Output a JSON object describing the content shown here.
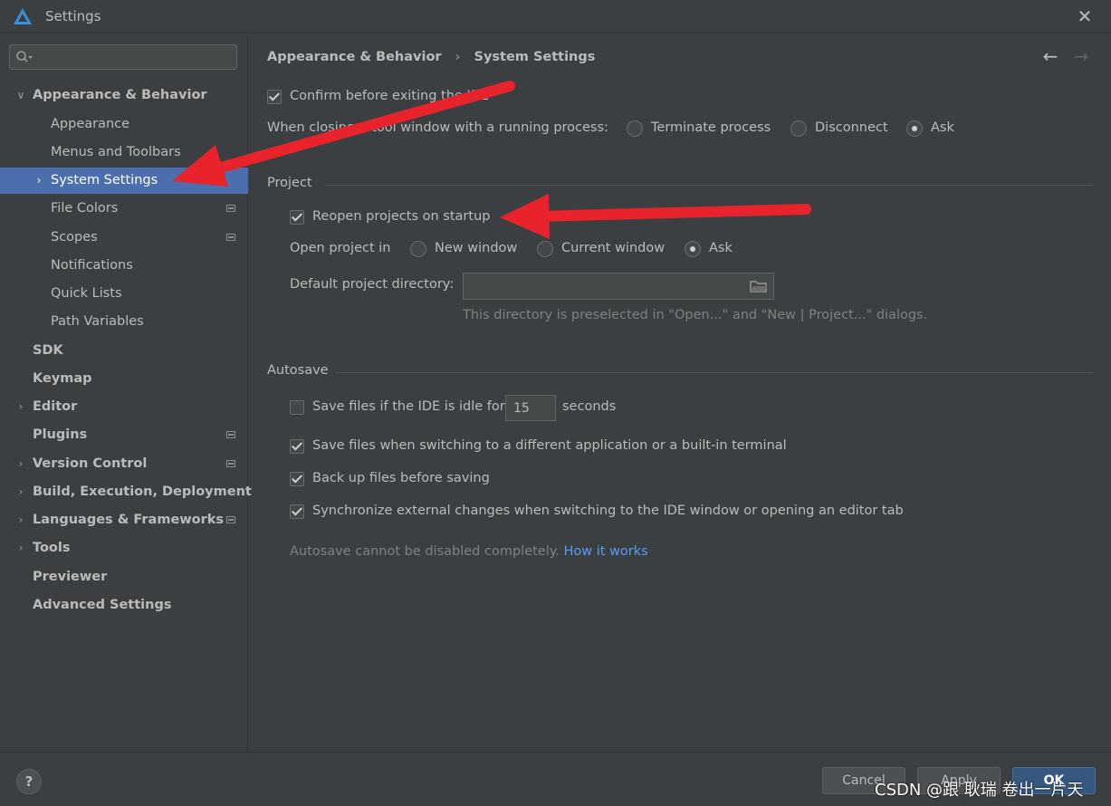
{
  "window": {
    "title": "Settings"
  },
  "search": {
    "placeholder": "",
    "value": ""
  },
  "sidebar": {
    "items": [
      {
        "label": "Appearance & Behavior",
        "bold": true,
        "expanded": true
      },
      {
        "label": "Appearance"
      },
      {
        "label": "Menus and Toolbars"
      },
      {
        "label": "System Settings",
        "selected": true
      },
      {
        "label": "File Colors"
      },
      {
        "label": "Scopes"
      },
      {
        "label": "Notifications"
      },
      {
        "label": "Quick Lists"
      },
      {
        "label": "Path Variables"
      },
      {
        "label": "SDK",
        "bold": true
      },
      {
        "label": "Keymap",
        "bold": true
      },
      {
        "label": "Editor",
        "bold": true
      },
      {
        "label": "Plugins",
        "bold": true
      },
      {
        "label": "Version Control",
        "bold": true
      },
      {
        "label": "Build, Execution, Deployment",
        "bold": true
      },
      {
        "label": "Languages & Frameworks",
        "bold": true
      },
      {
        "label": "Tools",
        "bold": true
      },
      {
        "label": "Previewer",
        "bold": true
      },
      {
        "label": "Advanced Settings",
        "bold": true
      }
    ]
  },
  "breadcrumb": {
    "parent": "Appearance & Behavior",
    "separator": "›",
    "current": "System Settings"
  },
  "general": {
    "confirm_exit_label": "Confirm before exiting the IDE",
    "confirm_exit_checked": true,
    "closing_label": "When closing a tool window with a running process:",
    "closing_options": [
      "Terminate process",
      "Disconnect",
      "Ask"
    ],
    "closing_selected": "Ask"
  },
  "project": {
    "title": "Project",
    "reopen_label": "Reopen projects on startup",
    "reopen_checked": true,
    "open_in_label": "Open project in",
    "open_in_options": [
      "New window",
      "Current window",
      "Ask"
    ],
    "open_in_selected": "Ask",
    "default_dir_label": "Default project directory:",
    "default_dir_value": "",
    "default_dir_hint": "This directory is preselected in \"Open...\" and \"New | Project...\" dialogs."
  },
  "autosave": {
    "title": "Autosave",
    "idle_label": "Save files if the IDE is idle for",
    "idle_checked": false,
    "idle_value": "15",
    "idle_unit": "seconds",
    "switch_label": "Save files when switching to a different application or a built-in terminal",
    "switch_checked": true,
    "backup_label": "Back up files before saving",
    "backup_checked": true,
    "sync_label": "Synchronize external changes when switching to the IDE window or opening an editor tab",
    "sync_checked": true,
    "note": "Autosave cannot be disabled completely.",
    "note_link": "How it works"
  },
  "footer": {
    "help": "?",
    "cancel": "Cancel",
    "apply": "Apply",
    "ok": "OK"
  },
  "watermark": "CSDN @跟 耿瑞 卷出一片天",
  "colors": {
    "accent": "#4b6eaf",
    "link": "#589df6",
    "arrow": "#e8232c",
    "background": "#3c3f41"
  }
}
